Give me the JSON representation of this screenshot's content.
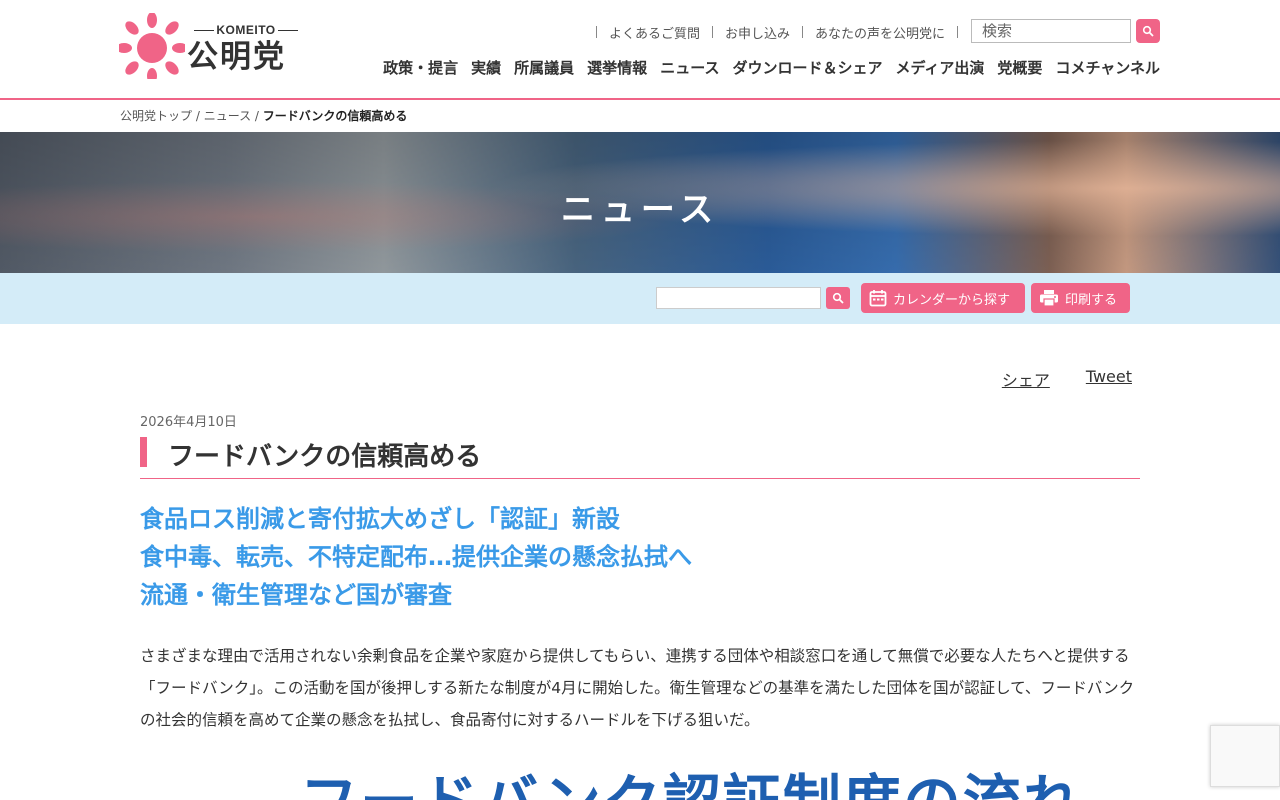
{
  "logo": {
    "en": "KOMEITO",
    "jp": "公明党"
  },
  "util_links": [
    "よくあるご質問",
    "お申し込み",
    "あなたの声を公明党に"
  ],
  "search": {
    "placeholder": "検索"
  },
  "gnav": [
    "政策・提言",
    "実績",
    "所属議員",
    "選挙情報",
    "ニュース",
    "ダウンロード＆シェア",
    "メディア出演",
    "党概要",
    "コメチャンネル"
  ],
  "breadcrumb": {
    "home": "公明党トップ",
    "section": "ニュース",
    "current": "フードバンクの信頼高める"
  },
  "hero": {
    "title": "ニュース"
  },
  "toolbar": {
    "calendar_label": "カレンダーから探す",
    "print_label": "印刷する"
  },
  "share": {
    "share_label": "シェア",
    "tweet_label": "Tweet"
  },
  "article": {
    "date": "2026年4月10日",
    "title": "フードバンクの信頼高める",
    "subheads": [
      "食品ロス削減と寄付拡大めざし「認証」新設",
      "食中毒、転売、不特定配布…提供企業の懸念払拭へ",
      "流通・衛生管理など国が審査"
    ],
    "body": "さまざまな理由で活用されない余剰食品を企業や家庭から提供してもらい、連携する団体や相談窓口を通して無償で必要な人たちへと提供する「フードバンク」。この活動を国が後押しする新たな制度が4月に開始した。衛生管理などの基準を満たした団体を国が認証して、フードバンクの社会的信頼を高めて企業の懸念を払拭し、食品寄付に対するハードルを下げる狙いだ。",
    "figure_title": "フードバンク認証制度の流れ"
  },
  "colors": {
    "accent": "#f06487",
    "subhead": "#3a9ae8",
    "toolbar_bg": "#d4ecf8"
  }
}
